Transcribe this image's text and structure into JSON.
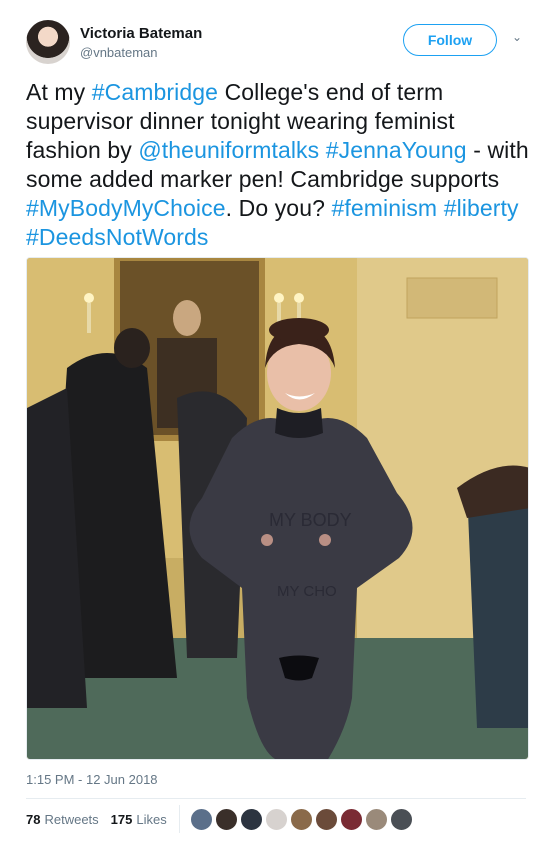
{
  "author": {
    "name": "Victoria Bateman",
    "handle": "@vnbateman"
  },
  "follow_label": "Follow",
  "tweet": {
    "segments": [
      {
        "text": "At my ",
        "tag": false
      },
      {
        "text": "#Cambridge",
        "tag": true
      },
      {
        "text": " College's end of term supervisor dinner tonight wearing feminist fashion by ",
        "tag": false
      },
      {
        "text": "@theuniformtalks",
        "tag": true
      },
      {
        "text": " ",
        "tag": false
      },
      {
        "text": "#JennaYoung",
        "tag": true
      },
      {
        "text": " - with some added marker pen! Cambridge supports ",
        "tag": false
      },
      {
        "text": "#MyBodyMyChoice",
        "tag": true
      },
      {
        "text": ". Do you? ",
        "tag": false
      },
      {
        "text": "#feminism",
        "tag": true
      },
      {
        "text": " ",
        "tag": false
      },
      {
        "text": "#liberty",
        "tag": true
      },
      {
        "text": " ",
        "tag": false
      },
      {
        "text": "#DeedsNotWords",
        "tag": true
      }
    ]
  },
  "photo": {
    "writing_line1": "MY BODY",
    "writing_line2": "MY CHO"
  },
  "timestamp": "1:15 PM - 12 Jun 2018",
  "stats": {
    "retweets_count": "78",
    "retweets_label": "Retweets",
    "likes_count": "175",
    "likes_label": "Likes"
  },
  "liker_colors": [
    "#5b6f8a",
    "#3a2f2a",
    "#2c3440",
    "#d7d2cf",
    "#8a6a4a",
    "#6b4b3a",
    "#7a2b34",
    "#9a8a7a",
    "#4a4f55"
  ],
  "colors": {
    "accent": "#1da1f2",
    "link": "#1b95e0",
    "muted": "#657786"
  }
}
